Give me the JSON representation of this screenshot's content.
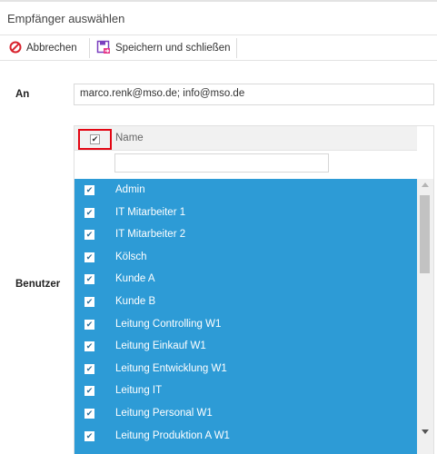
{
  "dialog": {
    "title": "Empfänger auswählen"
  },
  "toolbar": {
    "cancel_label": "Abbrechen",
    "save_label": "Speichern und schließen"
  },
  "form": {
    "to_label": "An",
    "to_value": "marco.renk@mso.de; info@mso.de",
    "users_label": "Benutzer"
  },
  "grid": {
    "header_checked": true,
    "column_name": "Name",
    "filter_value": "",
    "rows": [
      {
        "name": "Admin",
        "checked": true
      },
      {
        "name": "IT Mitarbeiter 1",
        "checked": true
      },
      {
        "name": "IT Mitarbeiter 2",
        "checked": true
      },
      {
        "name": "Kölsch",
        "checked": true
      },
      {
        "name": "Kunde A",
        "checked": true
      },
      {
        "name": "Kunde B",
        "checked": true
      },
      {
        "name": "Leitung Controlling W1",
        "checked": true
      },
      {
        "name": "Leitung Einkauf W1",
        "checked": true
      },
      {
        "name": "Leitung Entwicklung W1",
        "checked": true
      },
      {
        "name": "Leitung IT",
        "checked": true
      },
      {
        "name": "Leitung Personal W1",
        "checked": true
      },
      {
        "name": "Leitung Produktion A W1",
        "checked": true
      }
    ]
  },
  "colors": {
    "selection": "#2d9bd6",
    "highlight_border": "#e30613",
    "cancel_icon": "#d9232e",
    "save_icon": "#7a3fbf"
  },
  "icons": {
    "cancel": "no-entry-icon",
    "save": "save-close-icon"
  }
}
